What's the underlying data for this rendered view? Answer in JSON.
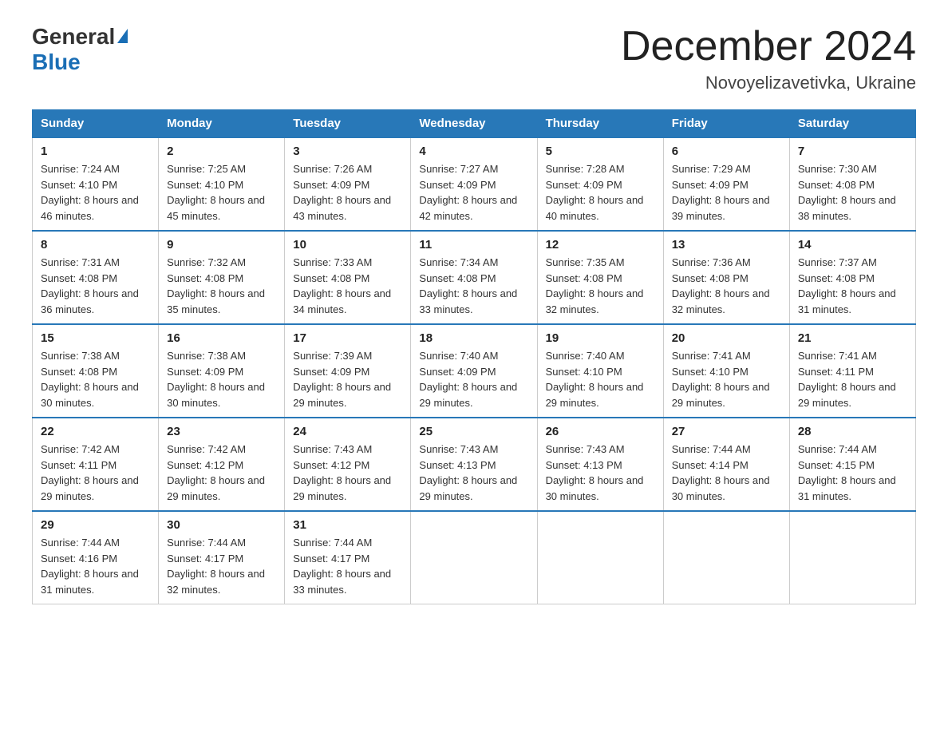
{
  "header": {
    "logo_general": "General",
    "logo_blue": "Blue",
    "month_title": "December 2024",
    "location": "Novoyelizavetivka, Ukraine"
  },
  "weekdays": [
    "Sunday",
    "Monday",
    "Tuesday",
    "Wednesday",
    "Thursday",
    "Friday",
    "Saturday"
  ],
  "weeks": [
    [
      {
        "day": "1",
        "sunrise": "Sunrise: 7:24 AM",
        "sunset": "Sunset: 4:10 PM",
        "daylight": "Daylight: 8 hours and 46 minutes."
      },
      {
        "day": "2",
        "sunrise": "Sunrise: 7:25 AM",
        "sunset": "Sunset: 4:10 PM",
        "daylight": "Daylight: 8 hours and 45 minutes."
      },
      {
        "day": "3",
        "sunrise": "Sunrise: 7:26 AM",
        "sunset": "Sunset: 4:09 PM",
        "daylight": "Daylight: 8 hours and 43 minutes."
      },
      {
        "day": "4",
        "sunrise": "Sunrise: 7:27 AM",
        "sunset": "Sunset: 4:09 PM",
        "daylight": "Daylight: 8 hours and 42 minutes."
      },
      {
        "day": "5",
        "sunrise": "Sunrise: 7:28 AM",
        "sunset": "Sunset: 4:09 PM",
        "daylight": "Daylight: 8 hours and 40 minutes."
      },
      {
        "day": "6",
        "sunrise": "Sunrise: 7:29 AM",
        "sunset": "Sunset: 4:09 PM",
        "daylight": "Daylight: 8 hours and 39 minutes."
      },
      {
        "day": "7",
        "sunrise": "Sunrise: 7:30 AM",
        "sunset": "Sunset: 4:08 PM",
        "daylight": "Daylight: 8 hours and 38 minutes."
      }
    ],
    [
      {
        "day": "8",
        "sunrise": "Sunrise: 7:31 AM",
        "sunset": "Sunset: 4:08 PM",
        "daylight": "Daylight: 8 hours and 36 minutes."
      },
      {
        "day": "9",
        "sunrise": "Sunrise: 7:32 AM",
        "sunset": "Sunset: 4:08 PM",
        "daylight": "Daylight: 8 hours and 35 minutes."
      },
      {
        "day": "10",
        "sunrise": "Sunrise: 7:33 AM",
        "sunset": "Sunset: 4:08 PM",
        "daylight": "Daylight: 8 hours and 34 minutes."
      },
      {
        "day": "11",
        "sunrise": "Sunrise: 7:34 AM",
        "sunset": "Sunset: 4:08 PM",
        "daylight": "Daylight: 8 hours and 33 minutes."
      },
      {
        "day": "12",
        "sunrise": "Sunrise: 7:35 AM",
        "sunset": "Sunset: 4:08 PM",
        "daylight": "Daylight: 8 hours and 32 minutes."
      },
      {
        "day": "13",
        "sunrise": "Sunrise: 7:36 AM",
        "sunset": "Sunset: 4:08 PM",
        "daylight": "Daylight: 8 hours and 32 minutes."
      },
      {
        "day": "14",
        "sunrise": "Sunrise: 7:37 AM",
        "sunset": "Sunset: 4:08 PM",
        "daylight": "Daylight: 8 hours and 31 minutes."
      }
    ],
    [
      {
        "day": "15",
        "sunrise": "Sunrise: 7:38 AM",
        "sunset": "Sunset: 4:08 PM",
        "daylight": "Daylight: 8 hours and 30 minutes."
      },
      {
        "day": "16",
        "sunrise": "Sunrise: 7:38 AM",
        "sunset": "Sunset: 4:09 PM",
        "daylight": "Daylight: 8 hours and 30 minutes."
      },
      {
        "day": "17",
        "sunrise": "Sunrise: 7:39 AM",
        "sunset": "Sunset: 4:09 PM",
        "daylight": "Daylight: 8 hours and 29 minutes."
      },
      {
        "day": "18",
        "sunrise": "Sunrise: 7:40 AM",
        "sunset": "Sunset: 4:09 PM",
        "daylight": "Daylight: 8 hours and 29 minutes."
      },
      {
        "day": "19",
        "sunrise": "Sunrise: 7:40 AM",
        "sunset": "Sunset: 4:10 PM",
        "daylight": "Daylight: 8 hours and 29 minutes."
      },
      {
        "day": "20",
        "sunrise": "Sunrise: 7:41 AM",
        "sunset": "Sunset: 4:10 PM",
        "daylight": "Daylight: 8 hours and 29 minutes."
      },
      {
        "day": "21",
        "sunrise": "Sunrise: 7:41 AM",
        "sunset": "Sunset: 4:11 PM",
        "daylight": "Daylight: 8 hours and 29 minutes."
      }
    ],
    [
      {
        "day": "22",
        "sunrise": "Sunrise: 7:42 AM",
        "sunset": "Sunset: 4:11 PM",
        "daylight": "Daylight: 8 hours and 29 minutes."
      },
      {
        "day": "23",
        "sunrise": "Sunrise: 7:42 AM",
        "sunset": "Sunset: 4:12 PM",
        "daylight": "Daylight: 8 hours and 29 minutes."
      },
      {
        "day": "24",
        "sunrise": "Sunrise: 7:43 AM",
        "sunset": "Sunset: 4:12 PM",
        "daylight": "Daylight: 8 hours and 29 minutes."
      },
      {
        "day": "25",
        "sunrise": "Sunrise: 7:43 AM",
        "sunset": "Sunset: 4:13 PM",
        "daylight": "Daylight: 8 hours and 29 minutes."
      },
      {
        "day": "26",
        "sunrise": "Sunrise: 7:43 AM",
        "sunset": "Sunset: 4:13 PM",
        "daylight": "Daylight: 8 hours and 30 minutes."
      },
      {
        "day": "27",
        "sunrise": "Sunrise: 7:44 AM",
        "sunset": "Sunset: 4:14 PM",
        "daylight": "Daylight: 8 hours and 30 minutes."
      },
      {
        "day": "28",
        "sunrise": "Sunrise: 7:44 AM",
        "sunset": "Sunset: 4:15 PM",
        "daylight": "Daylight: 8 hours and 31 minutes."
      }
    ],
    [
      {
        "day": "29",
        "sunrise": "Sunrise: 7:44 AM",
        "sunset": "Sunset: 4:16 PM",
        "daylight": "Daylight: 8 hours and 31 minutes."
      },
      {
        "day": "30",
        "sunrise": "Sunrise: 7:44 AM",
        "sunset": "Sunset: 4:17 PM",
        "daylight": "Daylight: 8 hours and 32 minutes."
      },
      {
        "day": "31",
        "sunrise": "Sunrise: 7:44 AM",
        "sunset": "Sunset: 4:17 PM",
        "daylight": "Daylight: 8 hours and 33 minutes."
      },
      null,
      null,
      null,
      null
    ]
  ]
}
